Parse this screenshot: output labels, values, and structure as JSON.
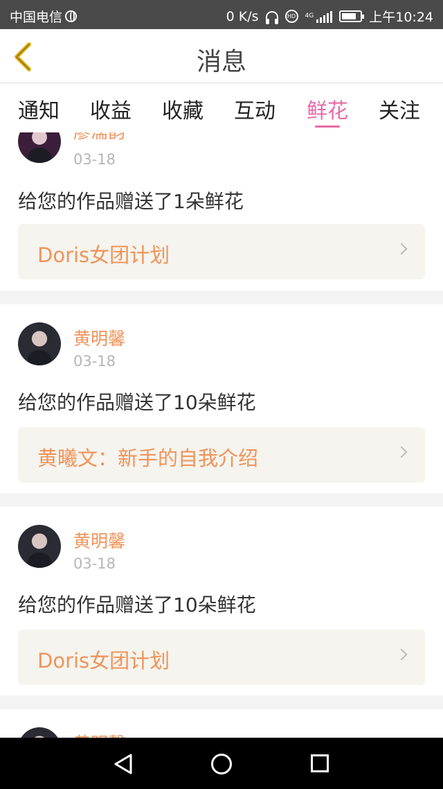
{
  "status_bar": {
    "carrier": "中国电信",
    "net_speed": "0 K/s",
    "net_type": "4G",
    "time": "上午10:24"
  },
  "header": {
    "title": "消息",
    "back_icon": "chevron-left-icon",
    "accent_color": "#e3b51b"
  },
  "tabs": [
    {
      "label": "通知",
      "active": false
    },
    {
      "label": "收益",
      "active": false
    },
    {
      "label": "收藏",
      "active": false
    },
    {
      "label": "互动",
      "active": false
    },
    {
      "label": "鲜花",
      "active": true
    },
    {
      "label": "关注",
      "active": false
    }
  ],
  "feed": {
    "items": [
      {
        "username": "廖濡韵",
        "date": "03-18",
        "message": "给您的作品赠送了1朵鲜花",
        "work_title": "Doris女团计划"
      },
      {
        "username": "黄明馨",
        "date": "03-18",
        "message": "给您的作品赠送了10朵鲜花",
        "work_title": "黄曦文：新手的自我介绍"
      },
      {
        "username": "黄明馨",
        "date": "03-18",
        "message": "给您的作品赠送了10朵鲜花",
        "work_title": "Doris女团计划"
      },
      {
        "username": "黄明馨",
        "date": "",
        "message": "",
        "work_title": ""
      }
    ]
  },
  "colors": {
    "tab_active": "#e86aa6",
    "name_and_work": "#f0935a",
    "work_bg": "#f5f4ee"
  }
}
